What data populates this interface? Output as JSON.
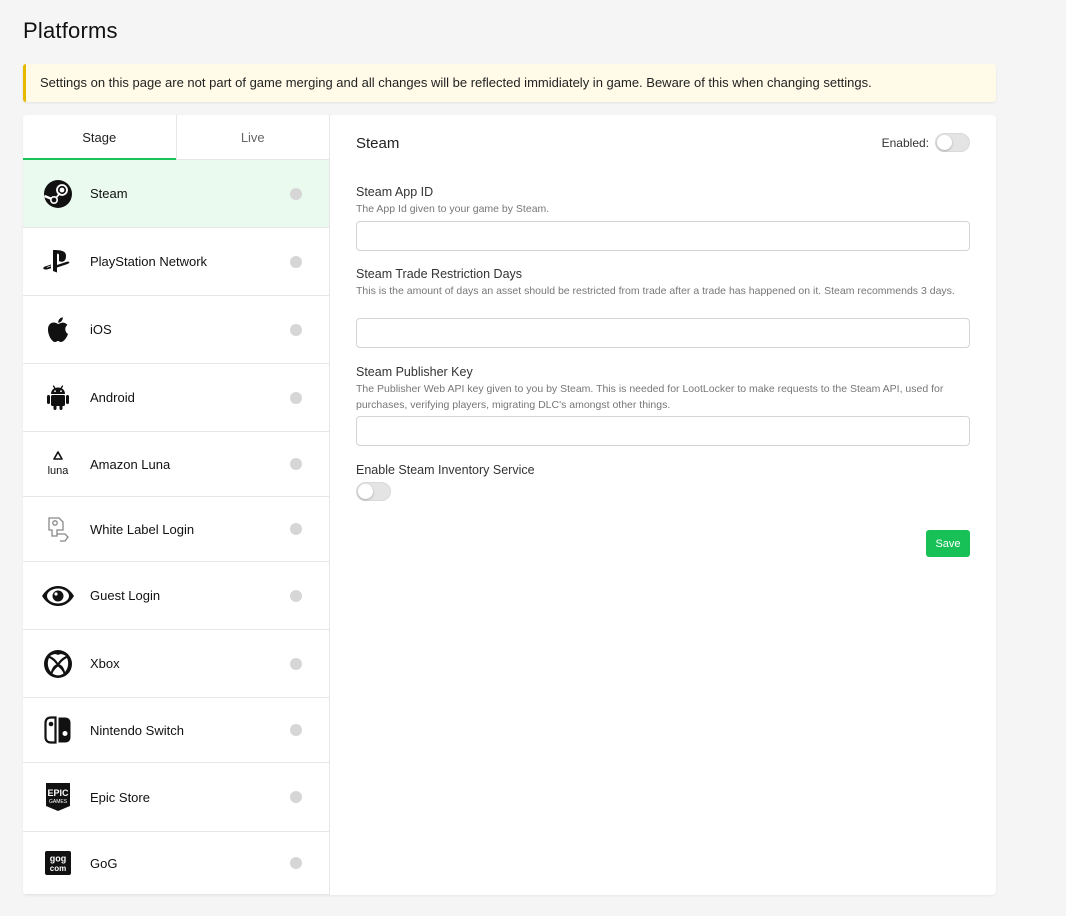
{
  "page": {
    "title": "Platforms",
    "notice": "Settings on this page are not part of game merging and all changes will be reflected immidiately in game. Beware of this when changing settings."
  },
  "sidebar": {
    "tabs": [
      {
        "label": "Stage",
        "active": true
      },
      {
        "label": "Live",
        "active": false
      }
    ],
    "platforms": [
      {
        "label": "Steam",
        "icon": "steam-icon",
        "active": true
      },
      {
        "label": "PlayStation Network",
        "icon": "playstation-icon",
        "active": false
      },
      {
        "label": "iOS",
        "icon": "apple-icon",
        "active": false
      },
      {
        "label": "Android",
        "icon": "android-icon",
        "active": false
      },
      {
        "label": "Amazon Luna",
        "icon": "luna-icon",
        "active": false
      },
      {
        "label": "White Label Login",
        "icon": "white-label-icon",
        "active": false
      },
      {
        "label": "Guest Login",
        "icon": "eye-icon",
        "active": false
      },
      {
        "label": "Xbox",
        "icon": "xbox-icon",
        "active": false
      },
      {
        "label": "Nintendo Switch",
        "icon": "switch-icon",
        "active": false
      },
      {
        "label": "Epic Store",
        "icon": "epic-icon",
        "active": false
      },
      {
        "label": "GoG",
        "icon": "gog-icon",
        "active": false
      }
    ]
  },
  "content": {
    "title": "Steam",
    "enabled_label": "Enabled:",
    "enabled": false,
    "fields": {
      "app_id": {
        "label": "Steam App ID",
        "help": "The App Id given to your game by Steam.",
        "value": ""
      },
      "trade_restriction": {
        "label": "Steam Trade Restriction Days",
        "help": "This is the amount of days an asset should be restricted from trade after a trade has happened on it. Steam recommends 3 days.",
        "value": ""
      },
      "publisher_key": {
        "label": "Steam Publisher Key",
        "help": "The Publisher Web API key given to you by Steam. This is needed for LootLocker to make requests to the Steam API, used for purchases, verifying players, migrating DLC's amongst other things.",
        "value": ""
      },
      "inventory_service": {
        "label": "Enable Steam Inventory Service",
        "enabled": false
      }
    },
    "save_label": "Save"
  },
  "colors": {
    "accent": "#17c157",
    "active_row": "#ebfaef",
    "notice_bg": "#fffbe8",
    "notice_border": "#e6b800"
  }
}
